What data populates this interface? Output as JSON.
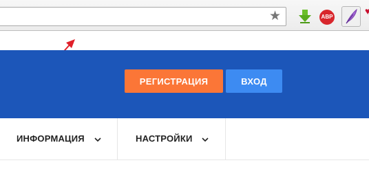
{
  "browser": {
    "star_icon": "star-icon",
    "extensions": [
      "download-arrow-icon",
      "adblock-icon",
      "feather-icon",
      "heart-icon"
    ],
    "abp_label": "ABP"
  },
  "header": {
    "register_label": "РЕГИСТРАЦИЯ",
    "login_label": "ВХОД",
    "background_color": "#1c56b9",
    "register_color": "#fb7637",
    "login_color": "#3d8bf2"
  },
  "nav": {
    "items": [
      {
        "label": "ИНФОРМАЦИЯ",
        "icon": "chevron-down-icon"
      },
      {
        "label": "НАСТРОЙКИ",
        "icon": "chevron-down-icon"
      }
    ]
  },
  "annotation": {
    "color": "#e0202a",
    "icon": "arrow-icon"
  }
}
